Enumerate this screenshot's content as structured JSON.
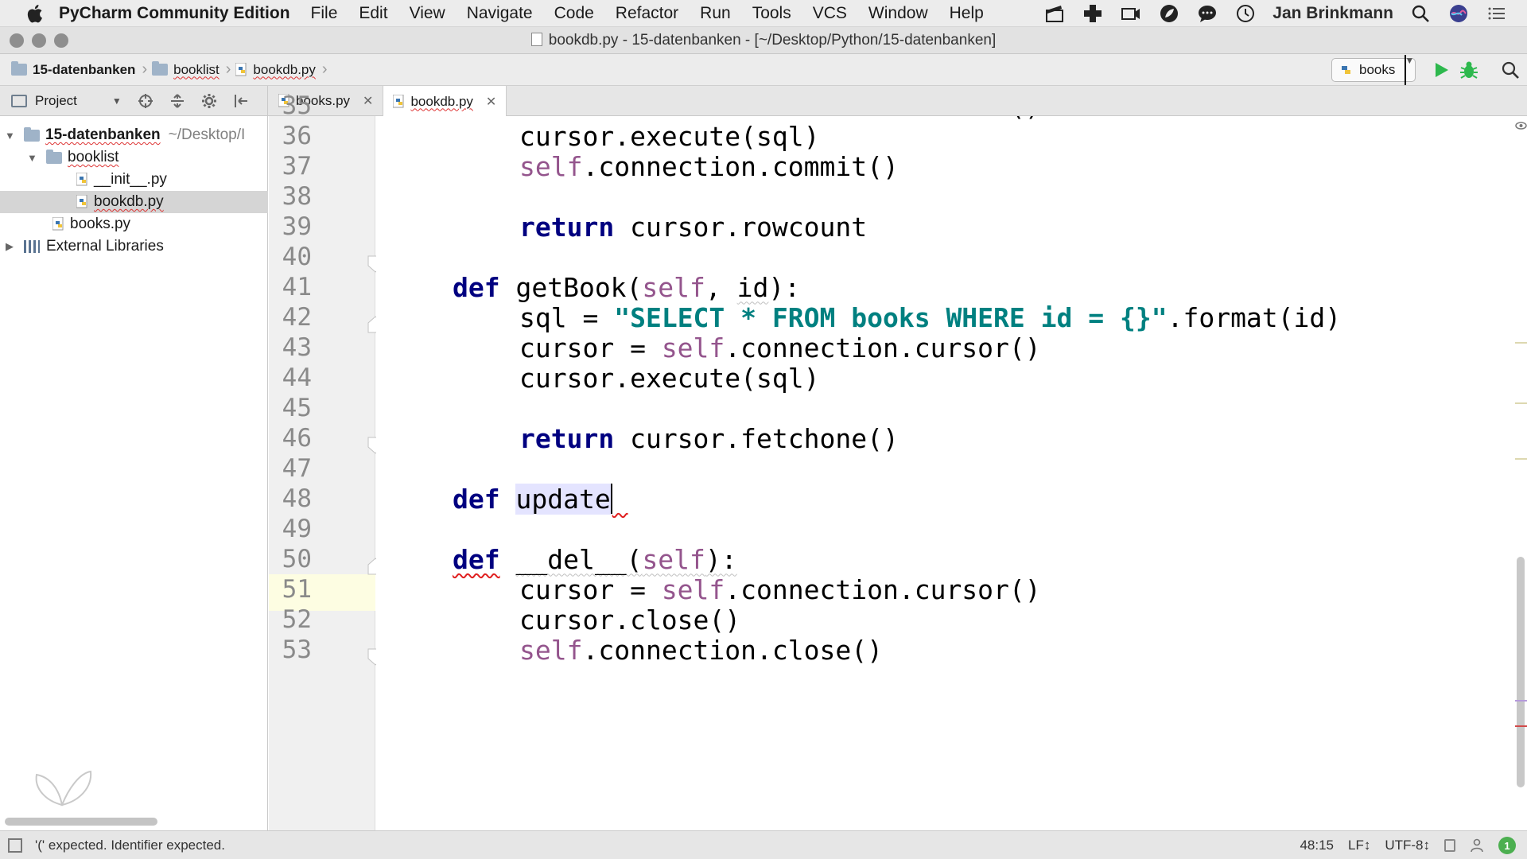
{
  "menubar": {
    "app_name": "PyCharm Community Edition",
    "items": [
      "File",
      "Edit",
      "View",
      "Navigate",
      "Code",
      "Refactor",
      "Run",
      "Tools",
      "VCS",
      "Window",
      "Help"
    ],
    "user": "Jan Brinkmann"
  },
  "window": {
    "title": "bookdb.py - 15-datenbanken - [~/Desktop/Python/15-datenbanken]"
  },
  "breadcrumb": [
    "15-datenbanken",
    "booklist",
    "bookdb.py"
  ],
  "run_config": {
    "label": "books"
  },
  "project_panel": {
    "label": "Project"
  },
  "tabs": [
    {
      "label": "books.py",
      "active": false
    },
    {
      "label": "bookdb.py",
      "active": true
    }
  ],
  "tree": {
    "root": "15-datenbanken",
    "root_hint": "~/Desktop/I",
    "folder": "booklist",
    "files": [
      "__init__.py",
      "bookdb.py",
      "books.py"
    ],
    "libraries": "External Libraries"
  },
  "editor": {
    "line_numbers": [
      "35",
      "36",
      "37",
      "38",
      "39",
      "40",
      "41",
      "42",
      "43",
      "44",
      "45",
      "46",
      "47",
      "48",
      "49",
      "50",
      "51",
      "52",
      "53"
    ],
    "current_line": "48"
  },
  "status": {
    "message": "'(' expected. Identifier expected.",
    "position": "48:15",
    "line_sep": "LF↕",
    "encoding": "UTF-8↕",
    "badge": "1"
  },
  "colors": {
    "keyword": "#000080",
    "self": "#94558d",
    "string": "#008080",
    "current_line": "#fdfde2",
    "run_green": "#2db84d"
  }
}
